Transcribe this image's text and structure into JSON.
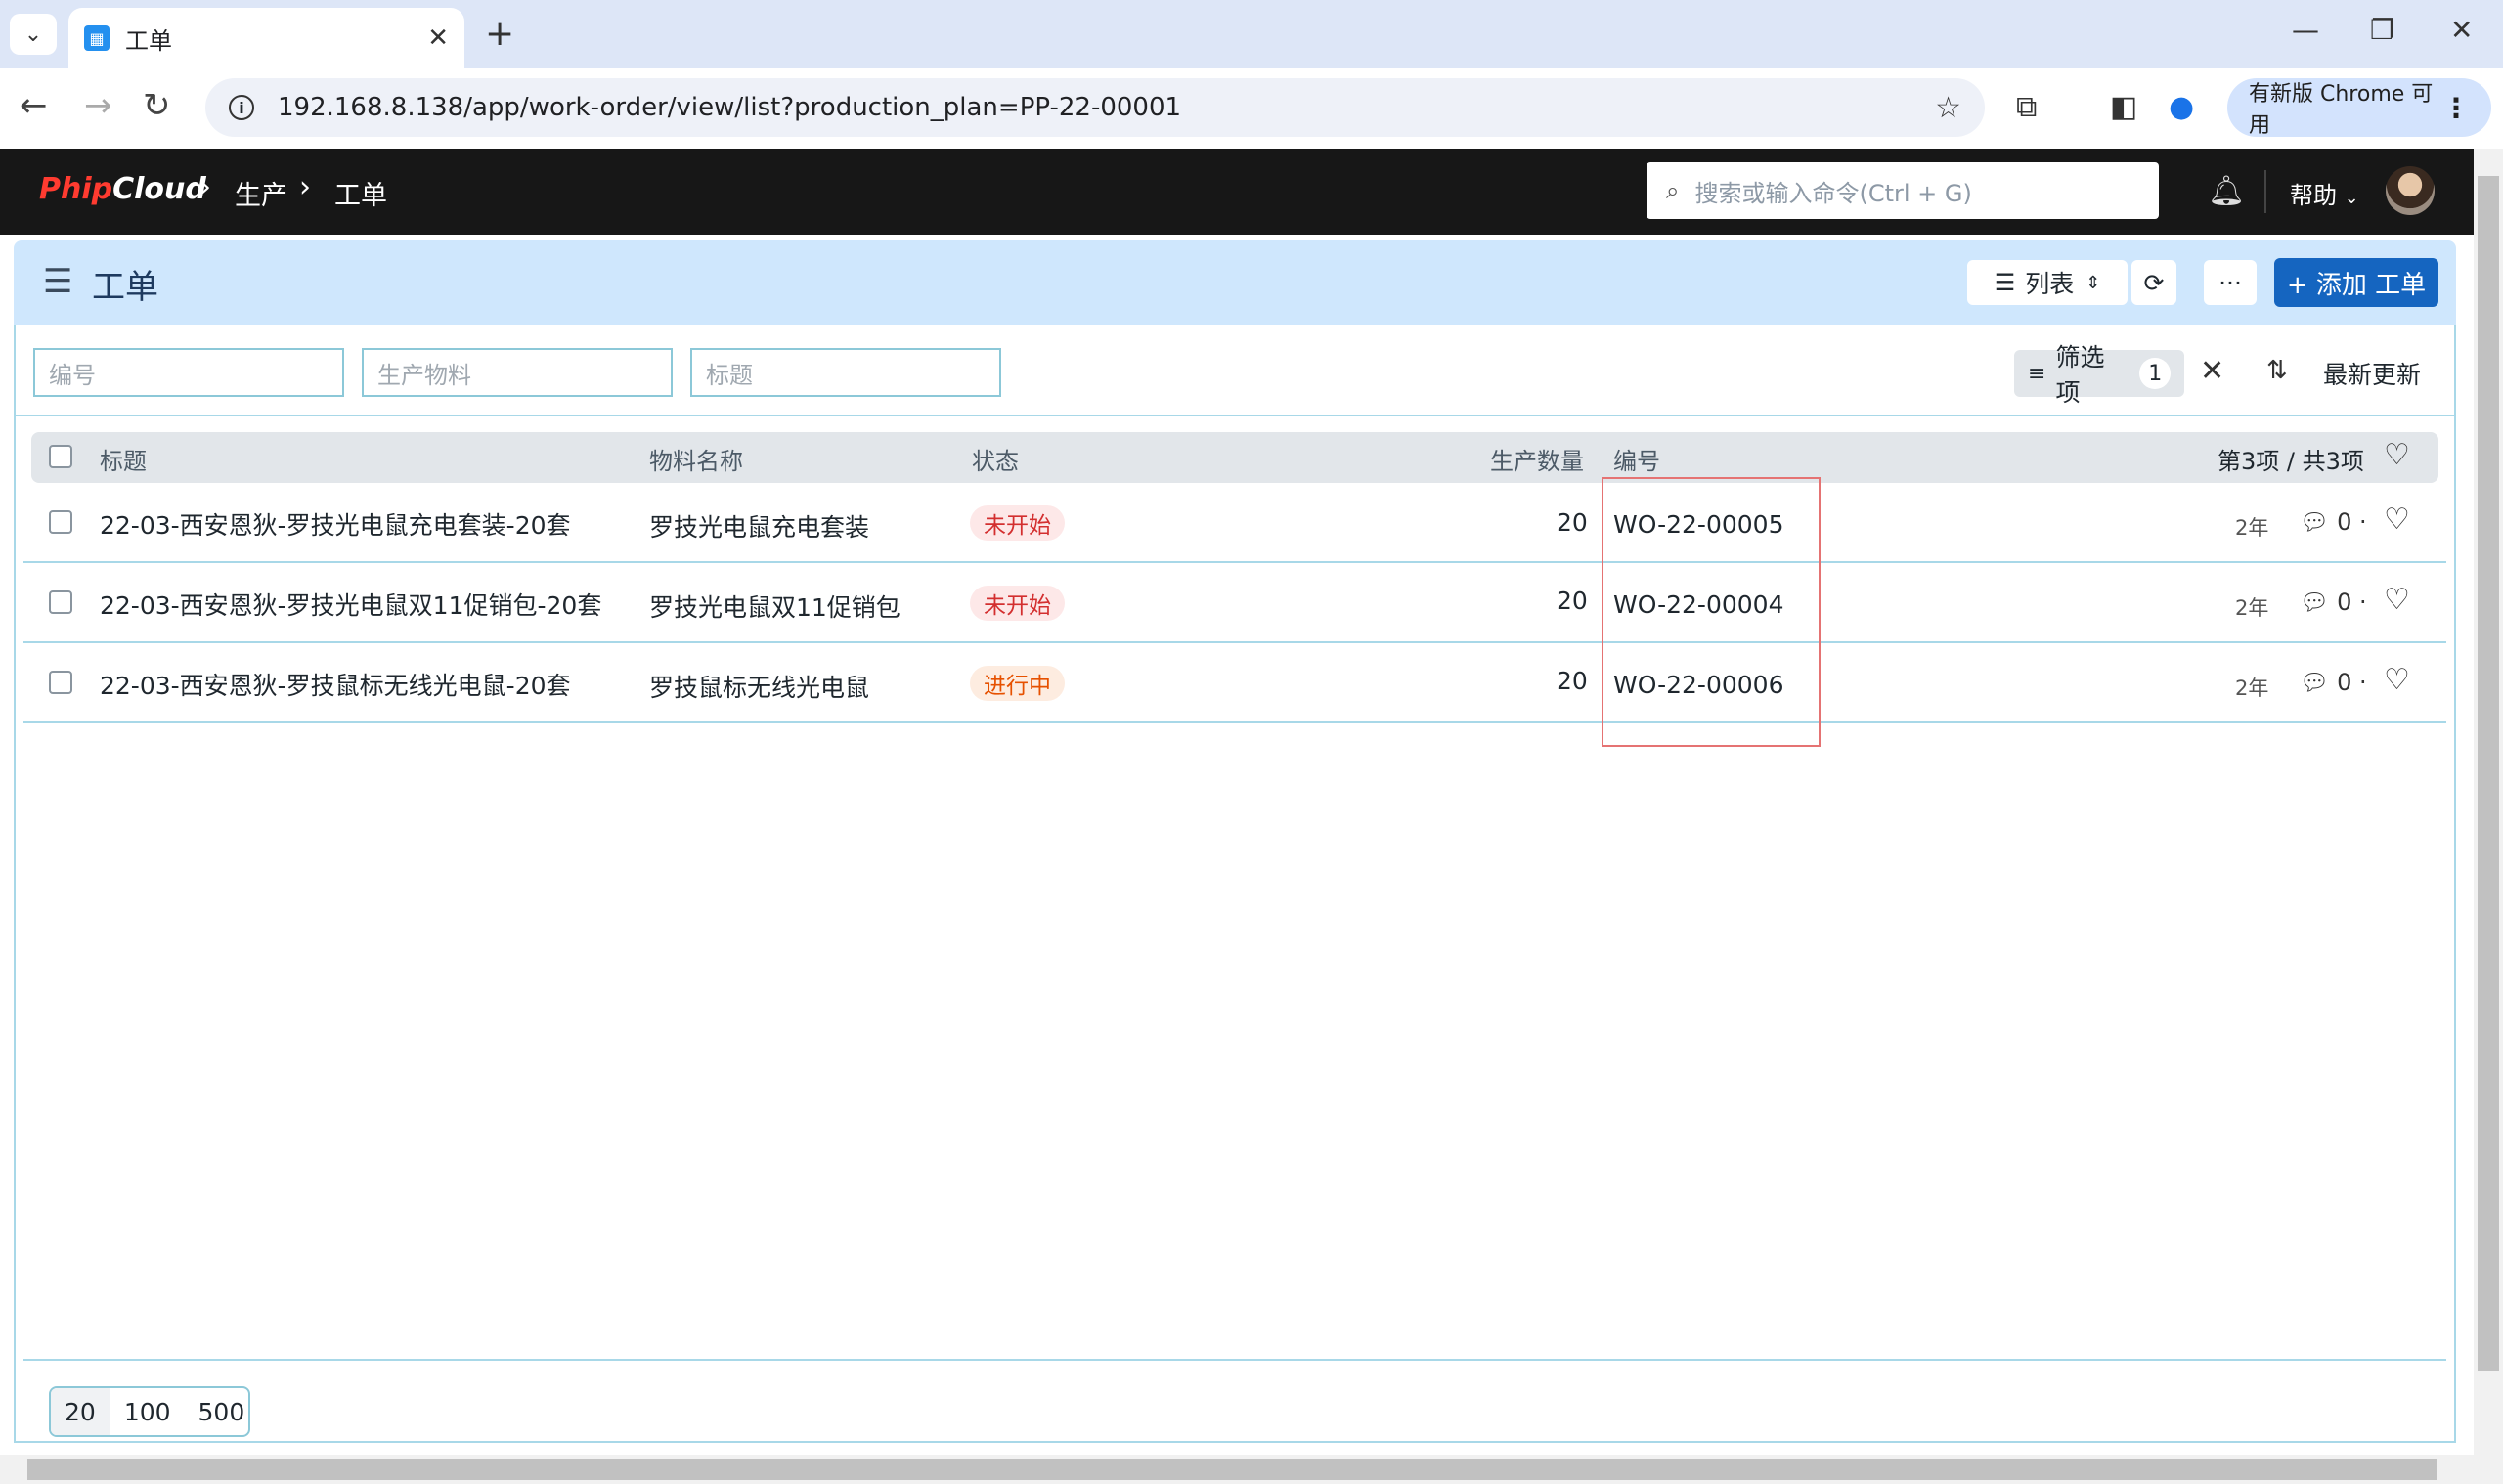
{
  "browser": {
    "tab_title": "工单",
    "url": "192.168.8.138/app/work-order/view/list?production_plan=PP-22-00001",
    "update_chip": "有新版 Chrome 可用"
  },
  "appbar": {
    "logo_a": "Phip",
    "logo_b": "Cloud",
    "breadcrumb": [
      "生产",
      "工单"
    ],
    "search_placeholder": "搜索或输入命令(Ctrl + G)",
    "help_label": "帮助"
  },
  "page": {
    "title": "工单",
    "view_label": "列表",
    "more_label": "···",
    "add_label": "+ 添加 工单"
  },
  "filters": {
    "inputs": [
      "编号",
      "生产物料",
      "标题"
    ],
    "chip_label": "筛选项",
    "chip_count": "1",
    "sort_label": "最新更新"
  },
  "table": {
    "headers": {
      "title": "标题",
      "item": "物料名称",
      "status": "状态",
      "qty": "生产数量",
      "code": "编号",
      "count": "第3项 / 共3项"
    },
    "rows": [
      {
        "title": "22-03-西安恩狄-罗技光电鼠充电套装-20套",
        "item": "罗技光电鼠充电套装",
        "status": "未开始",
        "qty": "20",
        "code": "WO-22-00005",
        "age": "2年",
        "comments": "0"
      },
      {
        "title": "22-03-西安恩狄-罗技光电鼠双11促销包-20套",
        "item": "罗技光电鼠双11促销包",
        "status": "未开始",
        "qty": "20",
        "code": "WO-22-00004",
        "age": "2年",
        "comments": "0"
      },
      {
        "title": "22-03-西安恩狄-罗技鼠标无线光电鼠-20套",
        "item": "罗技鼠标无线光电鼠",
        "status": "进行中",
        "qty": "20",
        "code": "WO-22-00006",
        "age": "2年",
        "comments": "0"
      }
    ]
  },
  "pager": [
    "20",
    "100",
    "500"
  ],
  "colors": {
    "primary": "#1565c0",
    "header_bg": "#cfe7fd",
    "status_not_started": "#d32f2f",
    "status_in_progress": "#e65100",
    "highlight": "#e57373"
  }
}
